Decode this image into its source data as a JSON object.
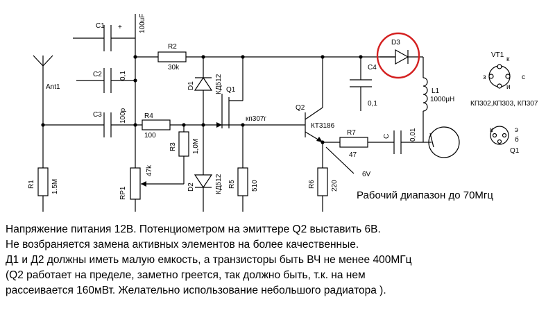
{
  "labels": {
    "c1": "C1",
    "c1_val": "100uF",
    "c1_plus": "+",
    "c2": "C2",
    "c2_val": "0,1",
    "c3": "C3",
    "c3_val": "100p",
    "c4": "C4",
    "c4_val": "0,1",
    "c5": "C",
    "c5_val": "0,01",
    "r1": "R1",
    "r1_val": "1.5M",
    "r2": "R2",
    "r2_val": "30k",
    "r3": "R3",
    "r3_val": "1,0M",
    "r4": "R4",
    "r4_val": "100",
    "r5": "R5",
    "r5_val": "510",
    "r6": "R6",
    "r6_val": "220",
    "r7": "R7",
    "r7_val": "47",
    "rp1": "RP1",
    "rp1_val": "47k",
    "d1": "D1",
    "d1_val": "КД512",
    "d2": "D2",
    "d2_val": "КД512",
    "d3": "D3",
    "q1": "Q1",
    "q1_val": "кп307г",
    "q2": "Q2",
    "q2_val": "КТ3186",
    "l1": "L1",
    "l1_val": "1000μH",
    "ant": "Ant1",
    "v6": "6V",
    "vt1": "VT1",
    "vt1_types": "КП302,КП303, КП307",
    "q1_pin": "Q1",
    "pin_k": "к",
    "pin_z": "з",
    "pin_s": "с",
    "pin_i": "и",
    "pin_e": "э",
    "pin_b": "б"
  },
  "range_text": "Рабочий диапазон  до 70Мгц",
  "notes": [
    "Напряжение питания 12В. Потенциометром  на эмиттере Q2 выставить 6В.",
    "Не возбраняется замена активных элементов на более качественные.",
    "Д1 и Д2 должны иметь малую емкость, а транзисторы быть ВЧ не менее 400МГц",
    "(Q2 работает на пределе, заметно греется, так должно быть, т.к. на нем",
    "рассеивается  160мВт. Желательно использование небольшого радиатора )."
  ],
  "highlight_color": "#d42020"
}
